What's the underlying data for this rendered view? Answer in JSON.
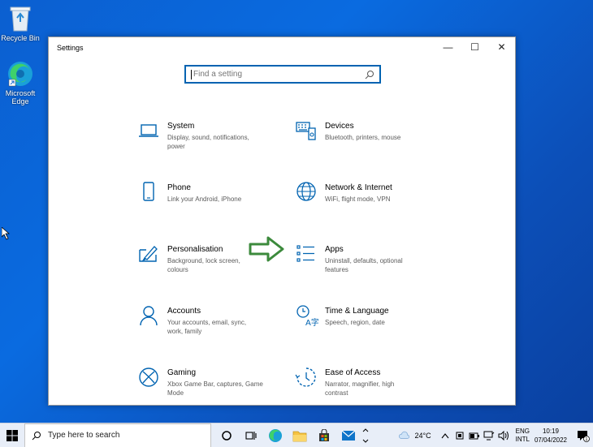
{
  "desktop": {
    "recycle_bin": "Recycle Bin",
    "edge": "Microsoft Edge"
  },
  "window": {
    "title": "Settings",
    "minimize": "—",
    "maximize": "☐",
    "close": "✕"
  },
  "search": {
    "placeholder": "Find a setting"
  },
  "tiles": [
    {
      "id": "system",
      "name": "System",
      "desc": "Display, sound, notifications, power"
    },
    {
      "id": "devices",
      "name": "Devices",
      "desc": "Bluetooth, printers, mouse"
    },
    {
      "id": "phone",
      "name": "Phone",
      "desc": "Link your Android, iPhone"
    },
    {
      "id": "network",
      "name": "Network & Internet",
      "desc": "WiFi, flight mode, VPN"
    },
    {
      "id": "personalisation",
      "name": "Personalisation",
      "desc": "Background, lock screen, colours"
    },
    {
      "id": "apps",
      "name": "Apps",
      "desc": "Uninstall, defaults, optional features"
    },
    {
      "id": "accounts",
      "name": "Accounts",
      "desc": "Your accounts, email, sync, work, family"
    },
    {
      "id": "time",
      "name": "Time & Language",
      "desc": "Speech, region, date"
    },
    {
      "id": "gaming",
      "name": "Gaming",
      "desc": "Xbox Game Bar, captures, Game Mode"
    },
    {
      "id": "ease",
      "name": "Ease of Access",
      "desc": "Narrator, magnifier, high contrast"
    }
  ],
  "taskbar": {
    "search_placeholder": "Type here to search",
    "temperature": "24°C",
    "lang_line1": "ENG",
    "lang_line2": "INTL",
    "time": "10:19",
    "date": "07/04/2022",
    "notification_count": "1"
  },
  "colors": {
    "accent": "#0063b1",
    "arrow": "#3c8a3c"
  }
}
